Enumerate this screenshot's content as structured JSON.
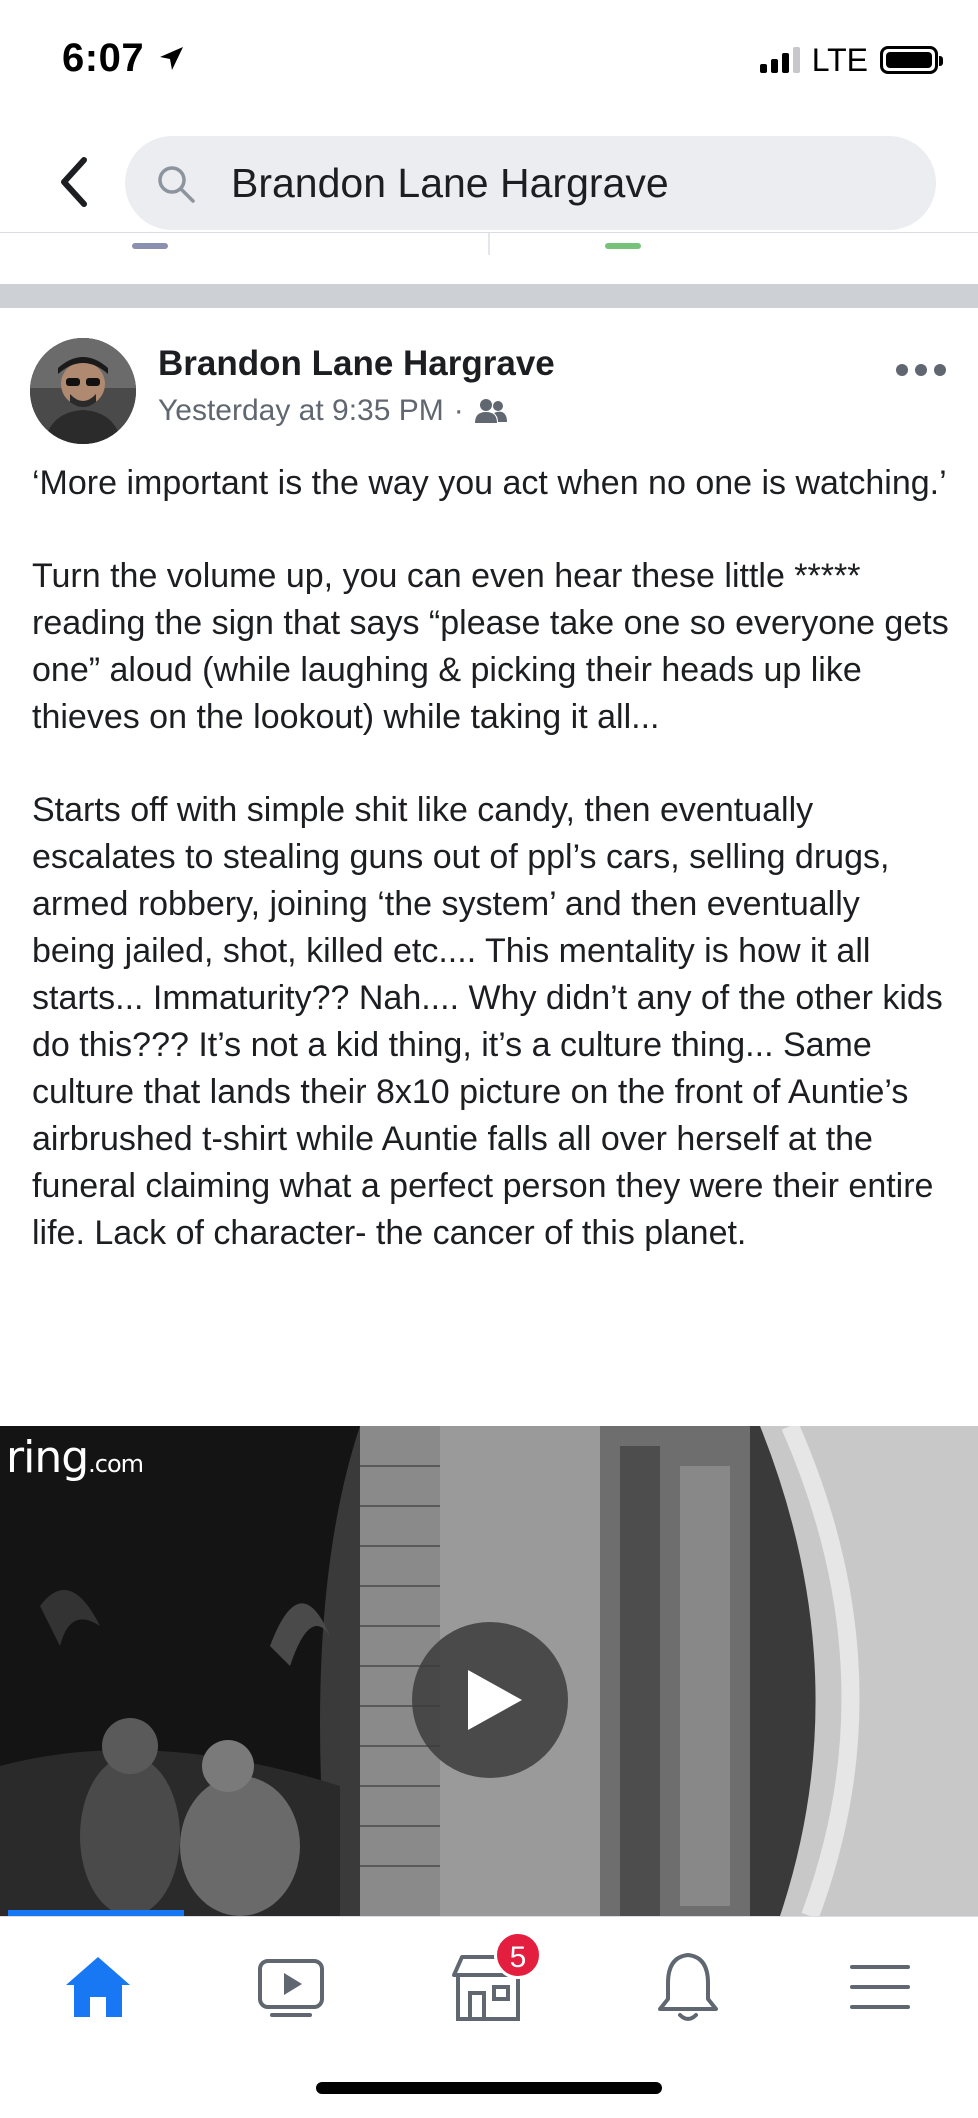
{
  "status_bar": {
    "time": "6:07",
    "network": "LTE"
  },
  "search": {
    "query": "Brandon Lane Hargrave"
  },
  "post": {
    "author": "Brandon Lane Hargrave",
    "timestamp": "Yesterday at 9:35 PM",
    "separator": "·",
    "audience_icon": "friends-icon",
    "paragraphs": [
      "‘More important is the way you act when no one is watching.’",
      "Turn the volume up, you can even hear these little ***** reading the sign that says “please take one so everyone gets one” aloud (while laughing & picking their heads up like thieves on the lookout) while taking it all...",
      "Starts off with simple shit like candy, then eventually escalates to stealing guns out of ppl’s cars, selling drugs, armed robbery, joining ‘the system’ and then eventually being jailed, shot, killed etc.... This mentality is how it all starts... Immaturity?? Nah.... Why didn’t any of the other kids do this??? It’s not a kid thing, it’s a culture thing... Same culture that lands their 8x10 picture on the front of Auntie’s airbrushed t-shirt while Auntie falls all over herself at the funeral claiming what a perfect person they were their entire life.  Lack of character- the cancer of this planet."
    ]
  },
  "video": {
    "watermark_main": "ring",
    "watermark_suffix": ".com",
    "progress": 0.18
  },
  "bottom_nav": {
    "items": [
      "home-icon",
      "video-icon",
      "marketplace-icon",
      "bell-icon",
      "menu-icon"
    ],
    "active": "home-icon",
    "marketplace_badge": "5"
  },
  "colors": {
    "accent": "#1877f2",
    "badge": "#e41e3f",
    "secondary_text": "#606770"
  }
}
